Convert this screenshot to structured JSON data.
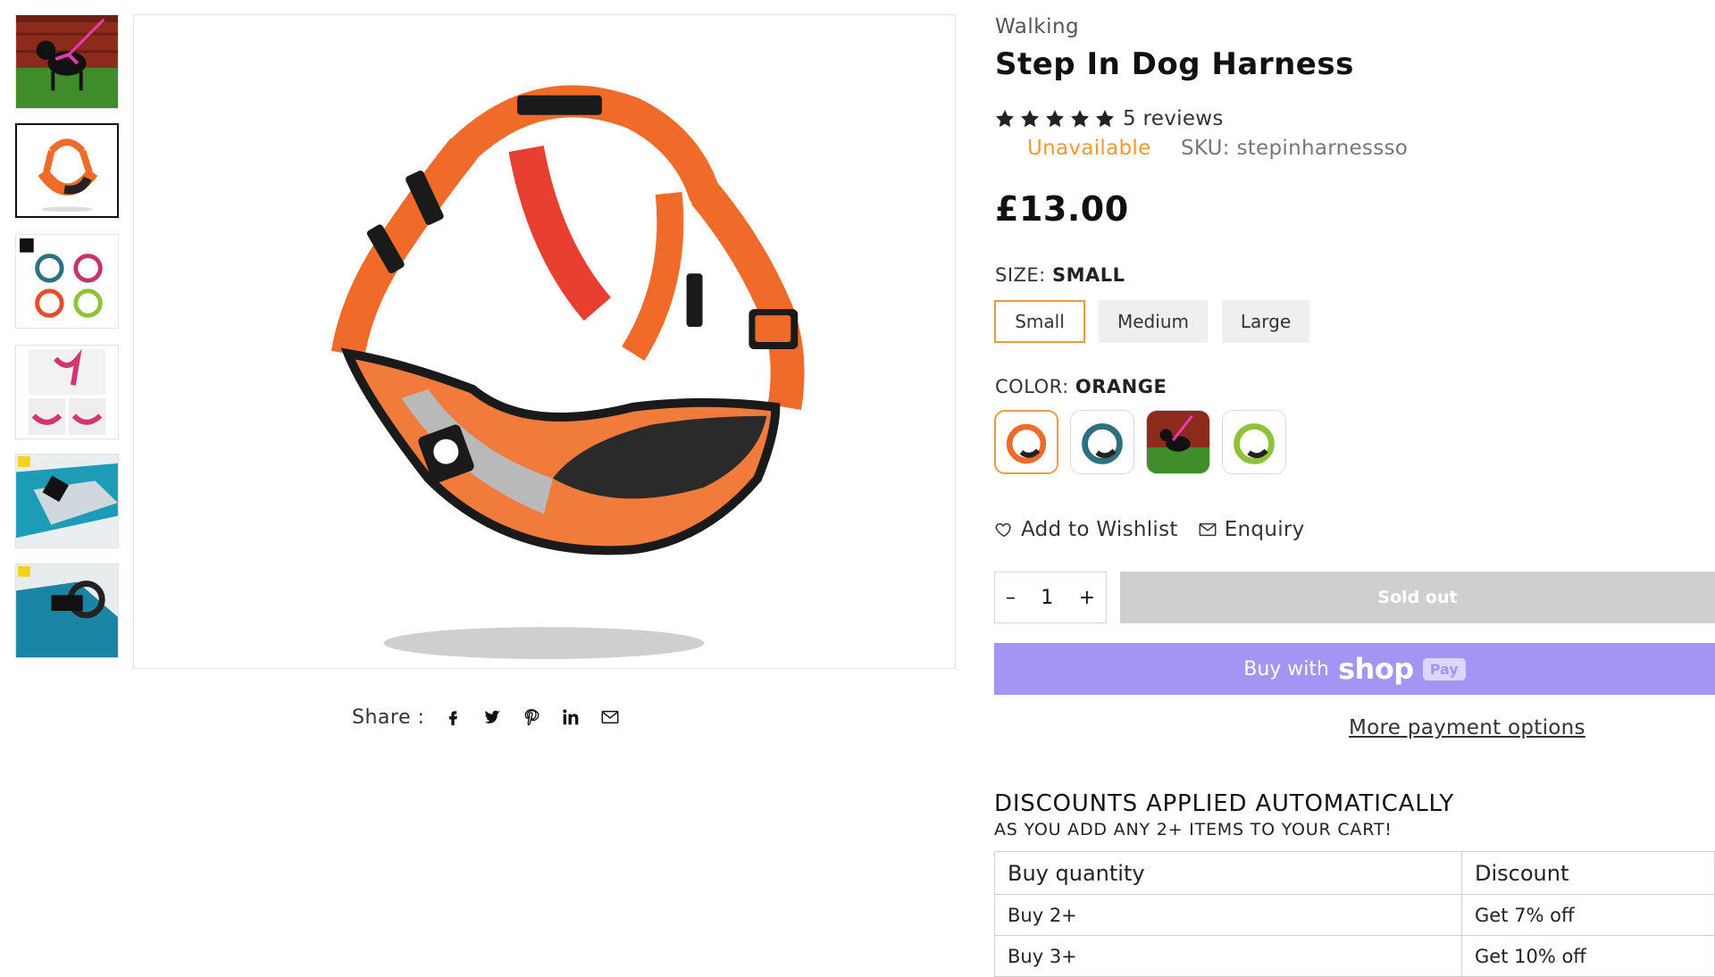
{
  "breadcrumb": "Walking",
  "product": {
    "title": "Step In Dog Harness",
    "rating_stars": 5,
    "reviews": "5 reviews",
    "availability": "Unavailable",
    "sku": "SKU: stepinharnessso",
    "price": "£13.00"
  },
  "thumbnails": [
    {
      "name": "dog-wearing-harness-photo"
    },
    {
      "name": "orange-harness-photo"
    },
    {
      "name": "four-color-harness-photo"
    },
    {
      "name": "pink-harness-photo"
    },
    {
      "name": "teal-harness-detail-photo"
    },
    {
      "name": "harness-buckle-detail-photo"
    }
  ],
  "share": {
    "label": "Share :",
    "icons": [
      "facebook-icon",
      "twitter-icon",
      "pinterest-icon",
      "linkedin-icon",
      "email-icon"
    ]
  },
  "size": {
    "label": "SIZE:",
    "selected": "SMALL",
    "options": [
      "Small",
      "Medium",
      "Large"
    ]
  },
  "color": {
    "label": "COLOR:",
    "selected": "ORANGE",
    "swatches": [
      "orange",
      "teal",
      "dog-photo",
      "green"
    ]
  },
  "actions": {
    "wishlist": "Add to Wishlist",
    "enquiry": "Enquiry",
    "qty_minus": "–",
    "qty_value": "1",
    "qty_plus": "+",
    "sold_out": "Sold out",
    "buy_with": "Buy with",
    "shop_brand": "shop",
    "shop_pay": "Pay",
    "more_payment": "More payment options"
  },
  "discounts": {
    "title": "DISCOUNTS APPLIED AUTOMATICALLY",
    "subtitle": "AS YOU ADD ANY 2+ ITEMS TO YOUR CART!",
    "headers": [
      "Buy quantity",
      "Discount"
    ],
    "rows": [
      [
        "Buy 2+",
        "Get 7% off"
      ],
      [
        "Buy 3+",
        "Get 10% off"
      ]
    ]
  },
  "colors": {
    "accent": "#f29a34",
    "harness": "#f06a2a",
    "shop_pay": "#a495f5",
    "sold_out": "#cfcfcf"
  }
}
